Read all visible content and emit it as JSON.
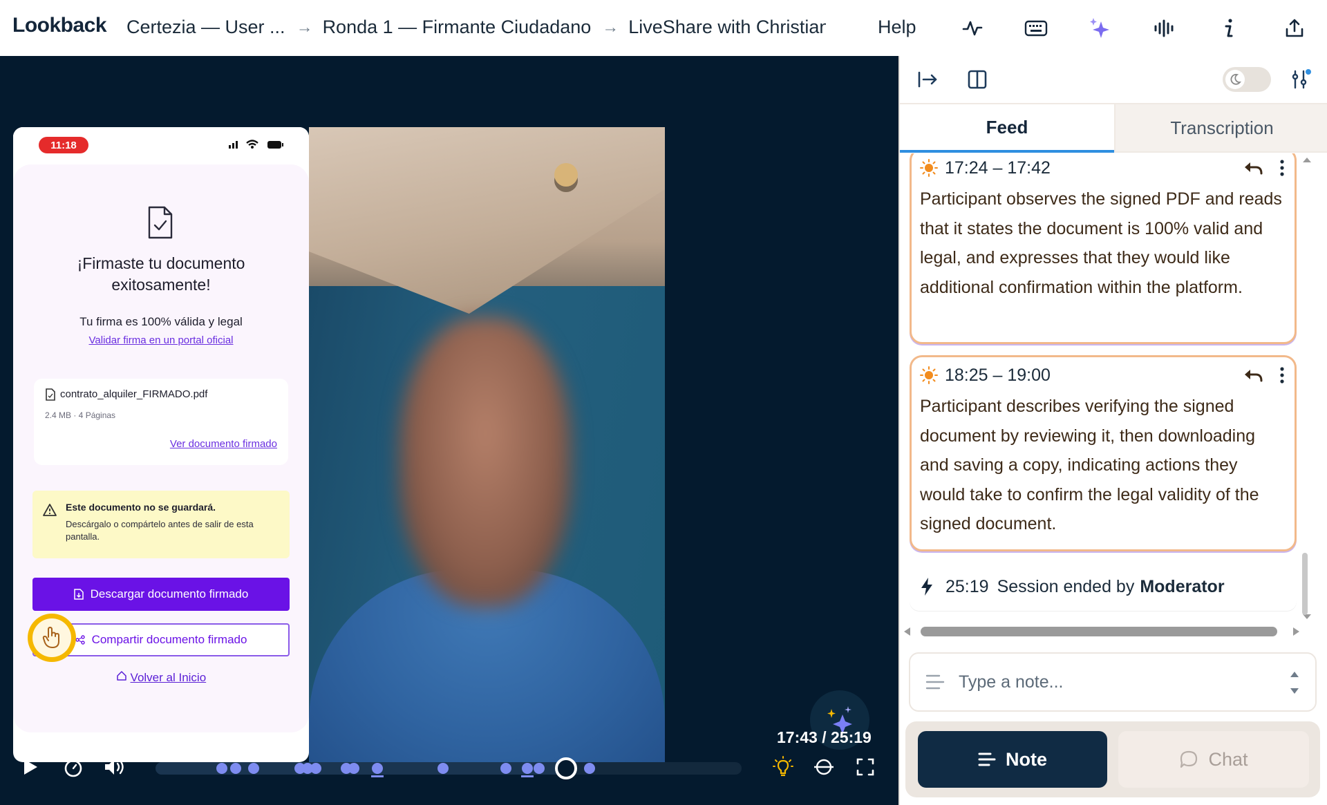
{
  "app": {
    "logo": "Lookback"
  },
  "breadcrumbs": [
    {
      "label": "Certezia — User ..."
    },
    {
      "label": "Ronda 1 — Firmante Ciudadano"
    },
    {
      "label": "LiveShare with Christian"
    }
  ],
  "header": {
    "help_label": "Help",
    "icons": [
      "activity-icon",
      "keyboard-icon",
      "ai-sparkles-icon",
      "audio-waveform-icon",
      "info-icon",
      "share-export-icon"
    ]
  },
  "phone": {
    "status_time": "11:18",
    "title": "¡Firmaste tu documento exitosamente!",
    "valid_text": "Tu firma es 100% válida y legal",
    "validate_link": "Validar firma en un portal oficial",
    "file": {
      "name": "contrato_alquiler_FIRMADO.pdf",
      "meta": "2.4 MB  ·  4 Páginas",
      "view_link": "Ver documento firmado"
    },
    "warning": {
      "title": "Este documento no se guardará.",
      "body": "Descárgalo o compártelo antes de salir de esta pantalla."
    },
    "download_button": "Descargar documento firmado",
    "share_button": "Compartir documento firmado",
    "home_link": "Volver al Inicio"
  },
  "player": {
    "timecode": "17:43 / 25:19",
    "position_fraction": 0.7,
    "marker_fractions": [
      0.113,
      0.137,
      0.168,
      0.247,
      0.26,
      0.273,
      0.325,
      0.338,
      0.378,
      0.49,
      0.598,
      0.635,
      0.655,
      0.74
    ],
    "colors": {
      "background": "#041a2e",
      "marker": "#7e8cf0"
    }
  },
  "panel": {
    "tabs": [
      {
        "label": "Feed",
        "active": true
      },
      {
        "label": "Transcription",
        "active": false
      }
    ],
    "feed": [
      {
        "time": "17:24 – 17:42",
        "text": "Participant observes the signed PDF and reads that it states the document is 100% valid and legal, and expresses that they would like additional confirmation within the platform."
      },
      {
        "time": "18:25 – 19:00",
        "text": "Participant describes verifying the signed document by reviewing it, then downloading and saving a copy, indicating actions they would take to confirm the legal validity of the signed document."
      }
    ],
    "session": {
      "time": "25:19",
      "text": "Session ended by",
      "by": "Moderator"
    },
    "note_placeholder": "Type a note...",
    "note_button": "Note",
    "chat_button": "Chat",
    "colors": {
      "card_border": "#f2b98a",
      "accent": "#2f8fe0",
      "note_button": "#102b44"
    }
  }
}
